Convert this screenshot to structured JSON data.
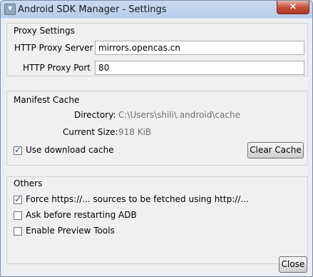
{
  "window": {
    "title": "Android SDK Manager - Settings",
    "close_glyph": "×"
  },
  "proxy": {
    "title": "Proxy Settings",
    "server_label": "HTTP Proxy Server",
    "server_value": "mirrors.opencas.cn",
    "port_label": "HTTP Proxy Port",
    "port_value": "80"
  },
  "manifest": {
    "title": "Manifest Cache",
    "directory_label": "Directory:",
    "directory_value": "C:\\Users\\shili\\.android\\cache",
    "size_label": "Current Size:",
    "size_value": "918 KiB",
    "use_cache_label": "Use download cache",
    "use_cache_checked": true,
    "clear_button": "Clear Cache"
  },
  "others": {
    "title": "Others",
    "options": [
      {
        "label": "Force https://... sources to be fetched using http://...",
        "checked": true
      },
      {
        "label": "Ask before restarting ADB",
        "checked": false
      },
      {
        "label": "Enable Preview Tools",
        "checked": false
      }
    ]
  },
  "footer": {
    "close_button": "Close"
  }
}
